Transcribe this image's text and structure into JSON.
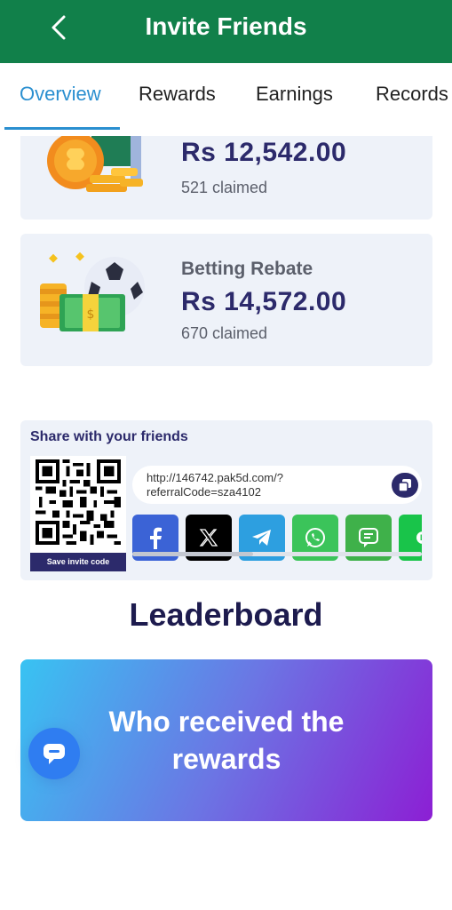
{
  "header": {
    "title": "Invite Friends"
  },
  "tabs": [
    {
      "label": "Overview",
      "active": true
    },
    {
      "label": "Rewards",
      "active": false
    },
    {
      "label": "Earnings",
      "active": false
    },
    {
      "label": "Records",
      "active": false
    }
  ],
  "rewards": [
    {
      "title": "",
      "amount": "Rs 12,542.00",
      "claimed": "521 claimed",
      "icon": "gold-coins-icon"
    },
    {
      "title": "Betting Rebate",
      "amount": "Rs 14,572.00",
      "claimed": "670 claimed",
      "icon": "football-cash-icon"
    }
  ],
  "share": {
    "title": "Share with your friends",
    "save_label": "Save invite code",
    "link": "http://146742.pak5d.com/?referralCode=sza4102",
    "link_line1": "http://146742.pak5d.com/?",
    "link_line2": "referralCode=sza4102",
    "socials": [
      {
        "name": "facebook",
        "color": "#3b63d6"
      },
      {
        "name": "x",
        "color": "#000000"
      },
      {
        "name": "telegram",
        "color": "#2d9fe0"
      },
      {
        "name": "whatsapp",
        "color": "#3bc45a"
      },
      {
        "name": "sms",
        "color": "#3fb14a"
      },
      {
        "name": "line",
        "color": "#19c44a",
        "label": "LI"
      }
    ]
  },
  "leaderboard": {
    "title": "Leaderboard",
    "banner_text": "Who received the rewards"
  },
  "colors": {
    "header_bg": "#11804a",
    "accent": "#2a8fd0",
    "navy": "#2c2a6b"
  }
}
